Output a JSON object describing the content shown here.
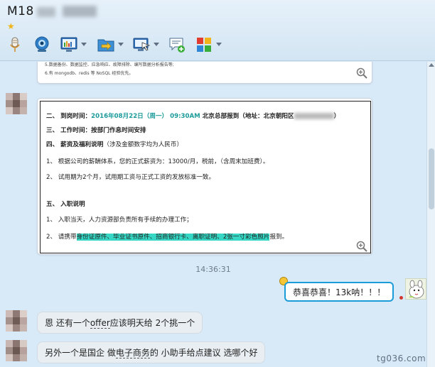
{
  "header": {
    "title": "M18",
    "star_glyph": "★"
  },
  "toolbar": {
    "buttons": [
      {
        "name": "microphone",
        "label": ""
      },
      {
        "name": "webcam",
        "label": ""
      },
      {
        "name": "screen-share",
        "label": ""
      },
      {
        "name": "file-transfer",
        "label": ""
      },
      {
        "name": "remote-desktop",
        "label": ""
      },
      {
        "name": "new-message",
        "label": ""
      },
      {
        "name": "apps",
        "label": ""
      }
    ]
  },
  "doc_top": {
    "line1": "5.数据备份、数据监控、应急响应、故障排除、编写数据分析报告等;",
    "line2": "6.有 mongodb、redis 等 NoSQL 经验优先。"
  },
  "doc_main": {
    "l1_prefix": "二、 到岗时间：",
    "l1_date": "2016年08月22日（周一）  09:30AM",
    "l1_suffix": "  北京总部报到（地址：北京朝阳区",
    "l2_title": "三、 工作时间：",
    "l2_body": "按部门作息时间安排",
    "l3_title": "四、 薪资及福利说明",
    "l3_note": "（涉及金额数字均为人民币）",
    "l4": "1、 根据公司的薪酬体系，您的正式薪资为：13000/月，税前，（含周末加班费）。",
    "l5": "2、 试用期为2个月，试用期工资与正式工资的发放标准一致。",
    "l6": "五、 入职说明",
    "l7": "1、 入职当天，人力资源部负责所有手续的办理工作；",
    "l8_prefix": "2、 请携带",
    "l8_highlight": "身份证原件、毕业证书原件、招商银行卡、离职证明、2张一寸彩色照片",
    "l8_suffix": "报到。"
  },
  "timestamp": "14:36:31",
  "messages": [
    {
      "side": "me",
      "text": "恭喜恭喜！13k呐！！！"
    },
    {
      "side": "them",
      "pre": "恩 还有一个",
      "underlined": "offer",
      "post": "应该明天给 2个挑一个"
    },
    {
      "side": "them",
      "pre": "另外一个是国企 做",
      "underlined": "电子商务",
      "post": "的 小助手给点建议 选哪个好"
    }
  ],
  "watermark": "tg036.com",
  "colors": {
    "chat_bg": "#d8e9f7",
    "accent_blue": "#1a9cd8",
    "highlight_teal": "#36d7c4",
    "date_teal": "#1a9a9a"
  }
}
